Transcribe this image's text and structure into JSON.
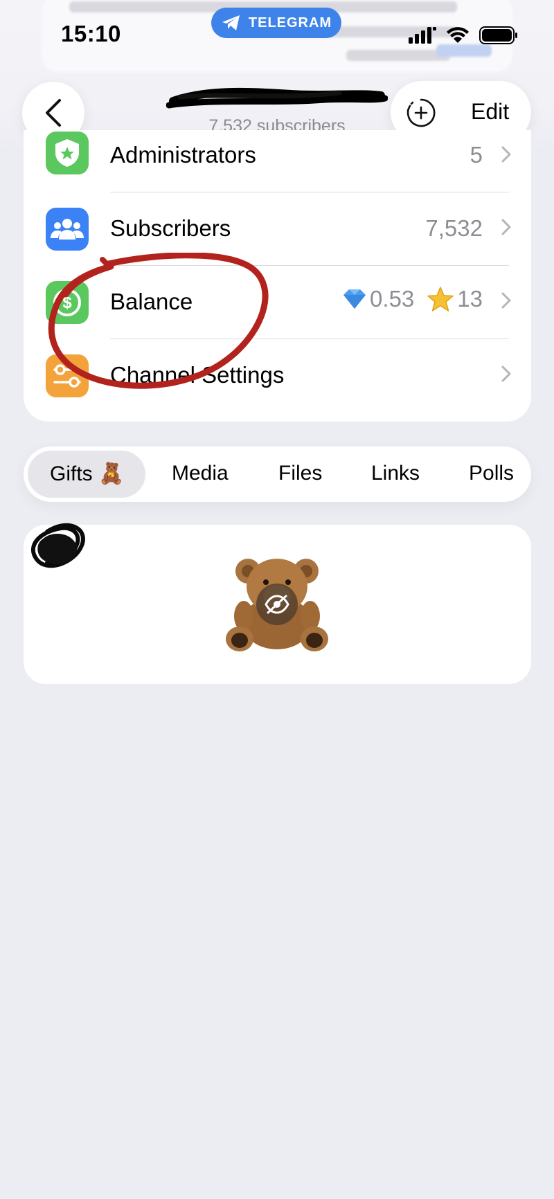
{
  "status_bar": {
    "time": "15:10",
    "app_pill": "TELEGRAM"
  },
  "header": {
    "subscribers_text": "7,532 subscribers",
    "edit_label": "Edit"
  },
  "settings": [
    {
      "label": "Administrators",
      "value": "5",
      "icon": "shield-star-icon",
      "color": "#5ac85f"
    },
    {
      "label": "Subscribers",
      "value": "7,532",
      "icon": "people-icon",
      "color": "#3a82f5"
    },
    {
      "label": "Balance",
      "ton": "0.53",
      "stars": "13",
      "icon": "dollar-icon",
      "color": "#5ac85f"
    },
    {
      "label": "Channel Settings",
      "value": "",
      "icon": "sliders-icon",
      "color": "#f4a23a"
    }
  ],
  "tabs": [
    {
      "label": "Gifts 🧸",
      "active": true
    },
    {
      "label": "Media"
    },
    {
      "label": "Files"
    },
    {
      "label": "Links"
    },
    {
      "label": "Polls"
    }
  ],
  "gifts": {
    "item": "teddy-bear-gift",
    "hidden": true
  }
}
